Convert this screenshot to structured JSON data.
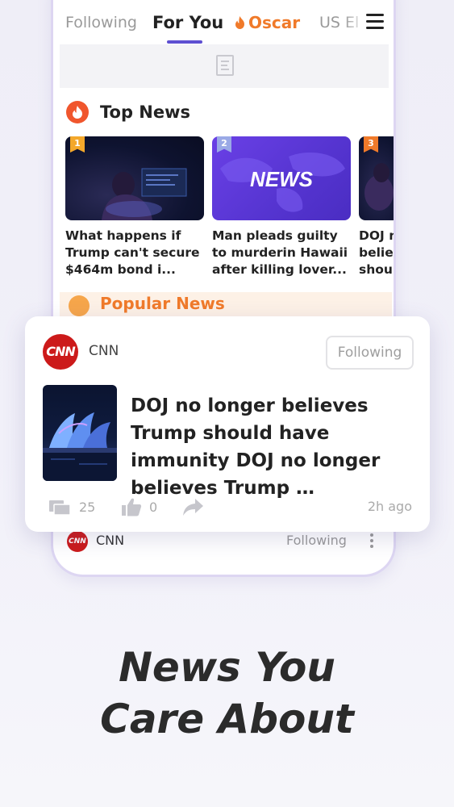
{
  "tabs": {
    "following": "Following",
    "for_you": "For You",
    "oscar": "Oscar",
    "us": "US El"
  },
  "top_news": {
    "title": "Top News",
    "cards": [
      {
        "rank": "1",
        "rank_color": "#f4a82b",
        "title": "What happens if Trump can't secure $464m bond i..."
      },
      {
        "rank": "2",
        "rank_color": "#9aa9e6",
        "image_text": "NEWS",
        "title": "Man pleads guilty to murderin Hawaii after killing lover..."
      },
      {
        "rank": "3",
        "rank_color": "#f07a2a",
        "title": "DOJ n belie shou"
      }
    ]
  },
  "popular_news": {
    "title": "Popular News"
  },
  "featured": {
    "logo_text": "CNN",
    "source": "CNN",
    "follow_label": "Following",
    "headline": "DOJ no longer believes Trump should have immunity DOJ no longer believes Trump …",
    "comments": "25",
    "likes": "0",
    "time": "2h ago"
  },
  "next_item": {
    "logo_text": "CNN",
    "source": "CNN",
    "follow_label": "Following"
  },
  "tagline": {
    "line1": "News You",
    "line2": "Care About"
  },
  "colors": {
    "accent": "#5d4fd1",
    "oscar": "#f07a2a",
    "cnn_red": "#cc1a1a"
  }
}
